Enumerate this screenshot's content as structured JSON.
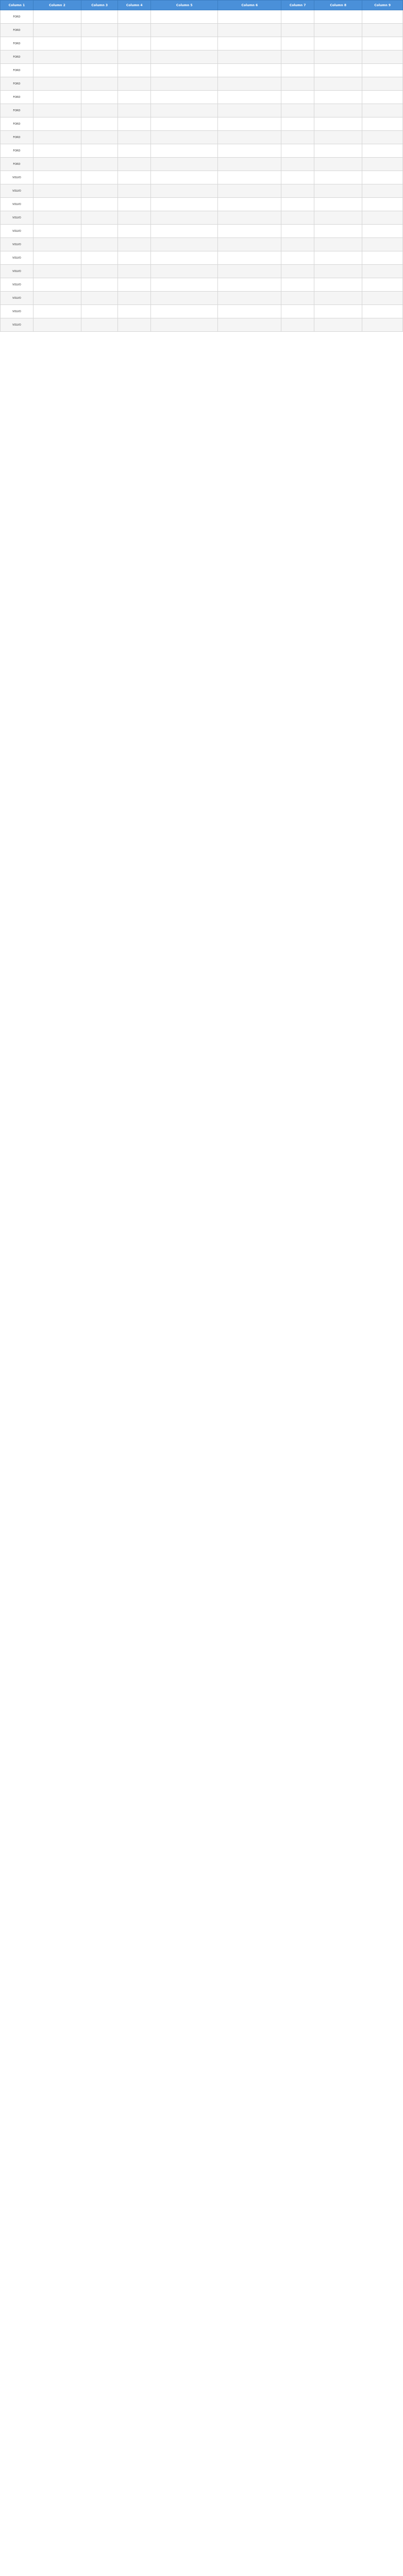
{
  "colors": {
    "header_bg": "#4a90d9",
    "badge_green": "#5cb85c",
    "badge_dark": "#333333",
    "badge_blue": "#5bc0de"
  },
  "table": {
    "columns": [
      "Column 1",
      "Column 2",
      "Column 3",
      "Column 4",
      "Column 5",
      "Column 6",
      "Column 7",
      "Column 8",
      "Column 9"
    ],
    "rows": [
      [
        "FORD",
        "",
        "",
        "",
        "",
        "",
        "",
        "",
        ""
      ],
      [
        "FORD",
        "",
        "",
        "",
        "",
        "",
        "",
        "",
        ""
      ],
      [
        "FORD",
        "",
        "",
        "",
        "",
        "",
        "",
        "",
        ""
      ],
      [
        "FORD",
        "",
        "",
        "",
        "",
        "",
        "",
        "",
        ""
      ],
      [
        "FORD",
        "",
        "",
        "",
        "",
        "",
        "",
        "",
        ""
      ],
      [
        "FORD",
        "",
        "",
        "",
        "",
        "",
        "",
        "",
        ""
      ],
      [
        "FORD",
        "",
        "",
        "",
        "",
        "",
        "",
        "",
        ""
      ],
      [
        "FORD",
        "",
        "",
        "",
        "",
        "",
        "",
        "",
        ""
      ],
      [
        "FORD",
        "",
        "",
        "",
        "",
        "",
        "",
        "",
        ""
      ],
      [
        "FORD",
        "",
        "",
        "",
        "",
        "",
        "",
        "",
        ""
      ],
      [
        "FORD",
        "",
        "",
        "",
        "",
        "",
        "",
        "",
        ""
      ],
      [
        "FORD",
        "",
        "",
        "",
        "",
        "",
        "",
        "",
        ""
      ],
      [
        "VOLVO",
        "",
        "",
        "",
        "",
        "",
        "",
        "",
        ""
      ],
      [
        "VOLVO",
        "",
        "",
        "",
        "",
        "",
        "",
        "",
        ""
      ],
      [
        "VOLVO",
        "",
        "",
        "",
        "",
        "",
        "",
        "",
        ""
      ],
      [
        "VOLVO",
        "",
        "",
        "",
        "",
        "",
        "",
        "",
        ""
      ],
      [
        "VOLVO",
        "",
        "",
        "",
        "",
        "",
        "",
        "",
        ""
      ],
      [
        "VOLVO",
        "",
        "",
        "",
        "",
        "",
        "",
        "",
        ""
      ],
      [
        "VOLVO",
        "",
        "",
        "",
        "",
        "",
        "",
        "",
        ""
      ],
      [
        "VOLVO",
        "",
        "",
        "",
        "",
        "",
        "",
        "",
        ""
      ],
      [
        "VOLVO",
        "",
        "",
        "",
        "",
        "",
        "",
        "",
        ""
      ],
      [
        "VOLVO",
        "",
        "",
        "",
        "",
        "",
        "",
        "",
        ""
      ],
      [
        "VOLVO",
        "",
        "",
        "",
        "",
        "",
        "",
        "",
        ""
      ],
      [
        "VOLVO",
        "",
        "",
        "",
        "",
        "",
        "",
        "",
        ""
      ]
    ]
  }
}
